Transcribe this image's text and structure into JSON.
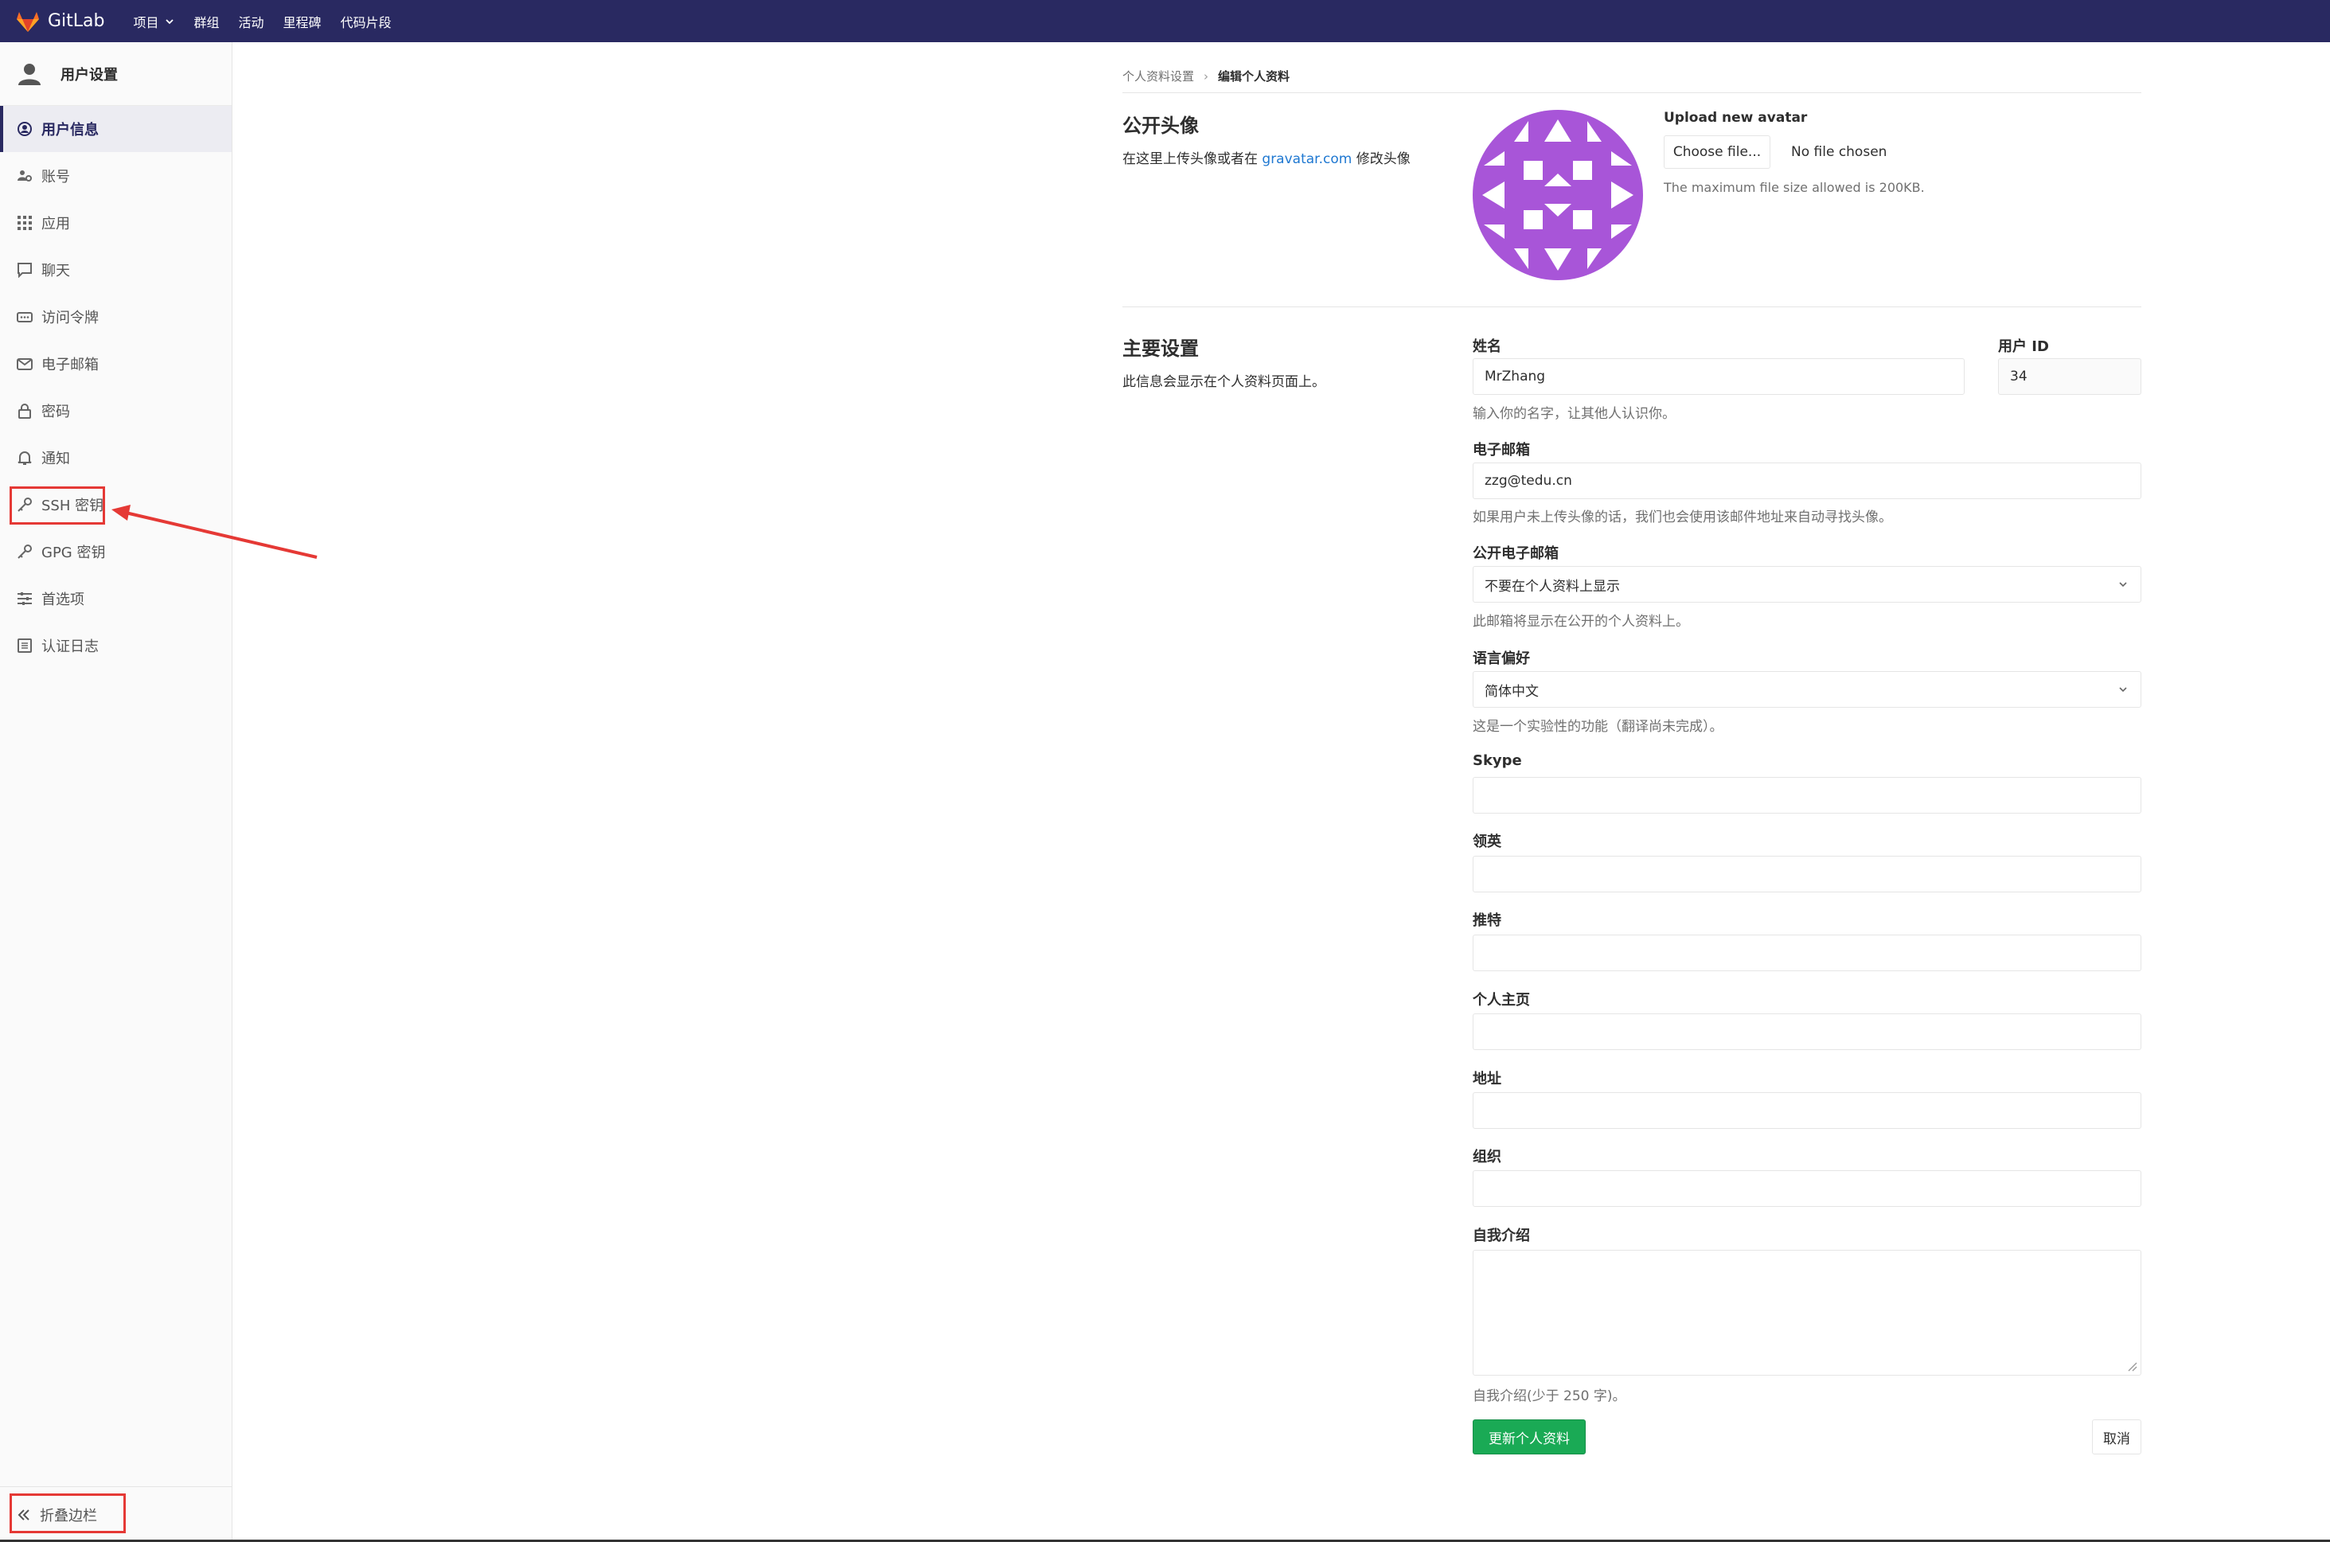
{
  "topbar": {
    "brand": "GitLab",
    "nav": [
      "项目",
      "群组",
      "活动",
      "里程碑",
      "代码片段"
    ]
  },
  "sidebar": {
    "title": "用户设置",
    "items": [
      {
        "label": "用户信息",
        "icon": "profile-icon"
      },
      {
        "label": "账号",
        "icon": "account-icon"
      },
      {
        "label": "应用",
        "icon": "applications-icon"
      },
      {
        "label": "聊天",
        "icon": "chat-icon"
      },
      {
        "label": "访问令牌",
        "icon": "token-icon"
      },
      {
        "label": "电子邮箱",
        "icon": "mail-icon"
      },
      {
        "label": "密码",
        "icon": "lock-icon"
      },
      {
        "label": "通知",
        "icon": "bell-icon"
      },
      {
        "label": "SSH 密钥",
        "icon": "key-icon"
      },
      {
        "label": "GPG 密钥",
        "icon": "key-icon"
      },
      {
        "label": "首选项",
        "icon": "preferences-icon"
      },
      {
        "label": "认证日志",
        "icon": "log-icon"
      }
    ],
    "collapse": "折叠边栏"
  },
  "breadcrumb": {
    "parent": "个人资料设置",
    "current": "编辑个人资料"
  },
  "avatar_section": {
    "title": "公开头像",
    "desc_prefix": "在这里上传头像或者在",
    "desc_link": "gravatar.com",
    "desc_suffix": "修改头像",
    "upload_label": "Upload new avatar",
    "choose_button": "Choose file...",
    "no_file": "No file chosen",
    "max_size_hint": "The maximum file size allowed is 200KB.",
    "avatar_color": "#a855d8"
  },
  "main_section": {
    "title": "主要设置",
    "desc": "此信息会显示在个人资料页面上。"
  },
  "form": {
    "name_label": "姓名",
    "name_value": "MrZhang",
    "name_help": "输入你的名字，让其他人认识你。",
    "userid_label": "用户 ID",
    "userid_value": "34",
    "email_label": "电子邮箱",
    "email_value": "zzg@tedu.cn",
    "email_help": "如果用户未上传头像的话，我们也会使用该邮件地址来自动寻找头像。",
    "public_email_label": "公开电子邮箱",
    "public_email_value": "不要在个人资料上显示",
    "public_email_help": "此邮箱将显示在公开的个人资料上。",
    "lang_label": "语言偏好",
    "lang_value": "简体中文",
    "lang_help": "这是一个实验性的功能（翻译尚未完成）。",
    "skype_label": "Skype",
    "linkedin_label": "领英",
    "twitter_label": "推特",
    "website_label": "个人主页",
    "location_label": "地址",
    "org_label": "组织",
    "bio_label": "自我介绍",
    "bio_help": "自我介绍(少于 250 字)。",
    "save_button": "更新个人资料",
    "cancel_button": "取消"
  },
  "colors": {
    "topbar": "#292961",
    "save": "#1aaa55",
    "highlight": "#e53935",
    "link": "#1f78d1"
  }
}
